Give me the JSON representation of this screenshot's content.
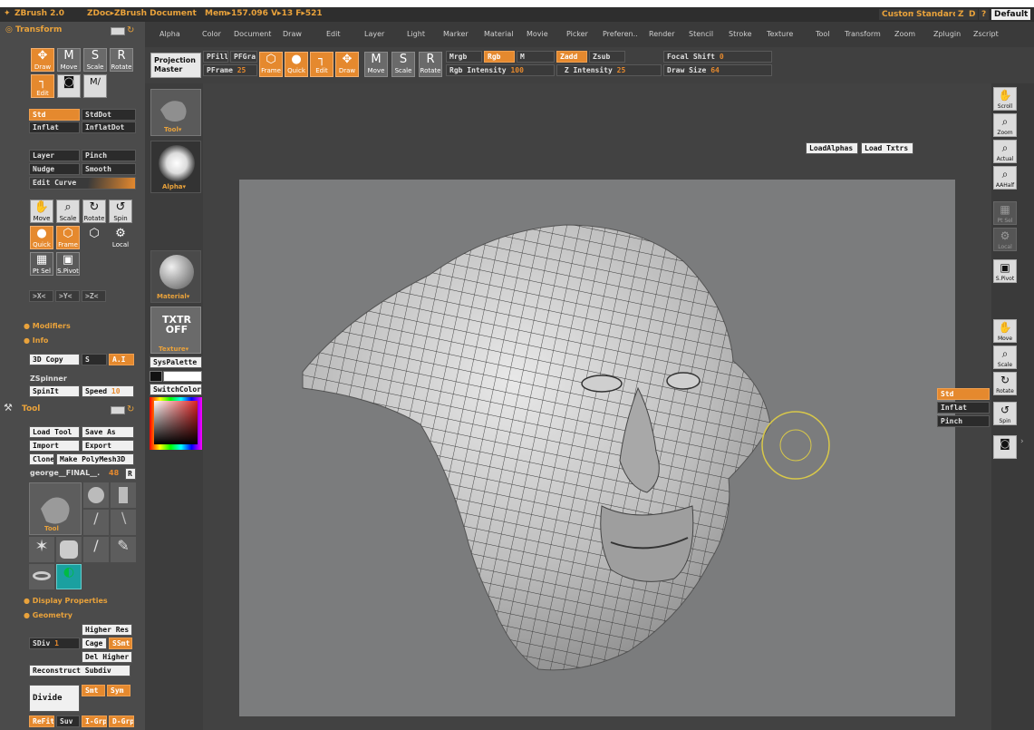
{
  "titlebar": {
    "app": "ZBrush 2.0",
    "doc": "ZDoc▸ZBrush Document",
    "mem": "Mem▸157.096 V▸13 F▸521",
    "custom": "Custom",
    "standard": "Standard",
    "z": "Z",
    "d": "D",
    "help": "?",
    "default": "Default"
  },
  "menu": [
    "Alpha",
    "Color",
    "Document",
    "Draw",
    "Edit",
    "Layer",
    "Light",
    "Marker",
    "Material",
    "Movie",
    "Picker",
    "Preferen..",
    "Render",
    "Stencil",
    "Stroke",
    "Texture",
    "Tool",
    "Transform",
    "Zoom",
    "Zplugin",
    "Zscript"
  ],
  "toolbar": {
    "projection_master": "Projection\nMaster",
    "pfill": "PFill",
    "pfgra": "PFGra",
    "pframe_label": "PFrame",
    "pframe_value": "25",
    "icons": [
      "Frame",
      "Quick",
      "Edit",
      "Draw",
      "Move",
      "Scale",
      "Rotate"
    ],
    "mrgb": "Mrgb",
    "rgb": "Rgb",
    "m": "M",
    "rgb_intensity_label": "Rgb Intensity",
    "rgb_intensity_value": "100",
    "zadd": "Zadd",
    "zsub": "Zsub",
    "z_intensity_label": "Z Intensity",
    "z_intensity_value": "25",
    "focal_shift_label": "Focal Shift",
    "focal_shift_value": "0",
    "draw_size_label": "Draw Size",
    "draw_size_value": "64"
  },
  "left": {
    "transform_header": "Transform",
    "tools": [
      "Draw",
      "Move",
      "Scale",
      "Rotate"
    ],
    "edit": "Edit",
    "std": "Std",
    "stddot": "StdDot",
    "inflat": "Inflat",
    "inflatdot": "InflatDot",
    "layer": "Layer",
    "pinch": "Pinch",
    "nudge": "Nudge",
    "smooth": "Smooth",
    "edit_curve": "Edit Curve",
    "move": "Move",
    "scale": "Scale",
    "rotate": "Rotate",
    "spin": "Spin",
    "quick": "Quick",
    "frame": "Frame",
    "local": "Local",
    "ptsel": "Pt Sel",
    "spivot": "S.Pivot",
    "axes": [
      ">X<",
      ">Y<",
      ">Z<"
    ],
    "modifiers": "Modifiers",
    "info": "Info",
    "copy3d": "3D Copy",
    "s": "S",
    "ai": "A.I",
    "zspinner": "ZSpinner",
    "spinit": "SpinIt",
    "speed_label": "Speed",
    "speed_value": "10",
    "tool_header": "Tool",
    "load_tool": "Load Tool",
    "save_as": "Save As",
    "import": "Import",
    "export": "Export",
    "clone": "Clone",
    "make_polymesh": "Make PolyMesh3D",
    "tool_name": "george__FINAL__.",
    "tool_num": "48",
    "r": "R",
    "tool_thumb_label": "Tool",
    "display_properties": "Display Properties",
    "geometry": "Geometry",
    "higher_res": "Higher Res",
    "sdiv_label": "SDiv",
    "sdiv_value": "1",
    "cage": "Cage",
    "ssmt": "SSmt",
    "del_higher": "Del Higher",
    "reconstruct": "Reconstruct Subdiv",
    "divide": "Divide",
    "smt": "Smt",
    "sym": "Sym",
    "bottom_row": [
      "ReFit",
      "Suv",
      "I-Grp",
      "D-Grp"
    ]
  },
  "col2": {
    "tool": "Tool",
    "alpha": "Alpha",
    "material": "Material",
    "txtr": "TXTR\nOFF",
    "texture": "Texture",
    "syspalette": "SysPalette",
    "switchcolor": "SwitchColor"
  },
  "canvas": {
    "load_alphas": "LoadAlphas",
    "load_txtrs": "Load Txtrs",
    "popup": [
      "Std",
      "Inflat",
      "Pinch"
    ]
  },
  "right": [
    {
      "g": "✋",
      "l": "Scroll"
    },
    {
      "g": "⌕",
      "l": "Zoom"
    },
    {
      "g": "⌕",
      "l": "Actual"
    },
    {
      "g": "⌕",
      "l": "AAHalf"
    },
    {
      "g": "▦",
      "l": "Pt Sel"
    },
    {
      "g": "⚙",
      "l": "Local"
    },
    {
      "g": "▣",
      "l": "S.Pivot"
    },
    {
      "g": "✋",
      "l": "Move"
    },
    {
      "g": "⌕",
      "l": "Scale"
    },
    {
      "g": "↻",
      "l": "Rotate"
    },
    {
      "g": "↺",
      "l": "Spin"
    },
    {
      "g": "◙",
      "l": ""
    }
  ],
  "colors": {
    "accent": "#e5892e",
    "panel": "#4b4b4b",
    "canvas": "#7b7c7d",
    "brush_ring": "#d8c84a"
  }
}
